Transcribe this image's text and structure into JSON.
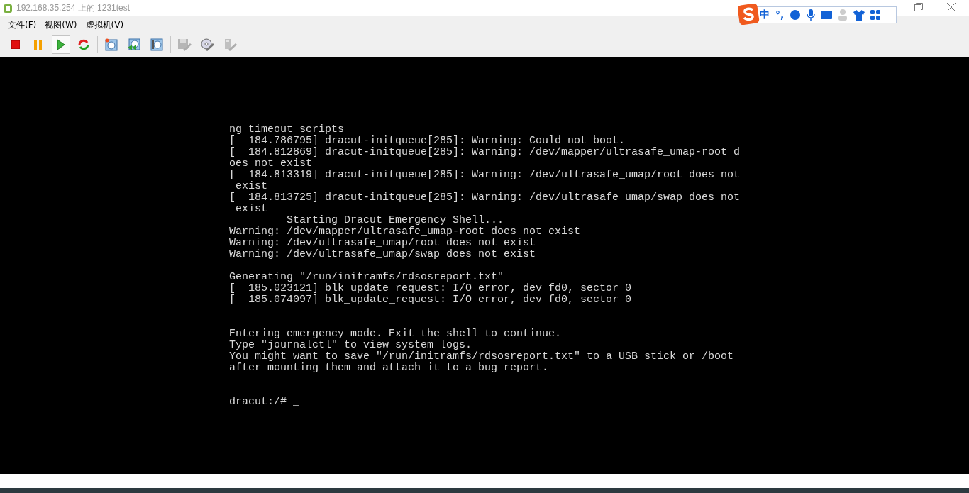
{
  "window": {
    "title": "192.168.35.254 上的 1231test"
  },
  "ime_bar": {
    "mode": "中",
    "punctuation": "°,"
  },
  "menu": [
    "文件(F)",
    "视图(W)",
    "虚拟机(V)"
  ],
  "toolbar": [
    {
      "kind": "stop",
      "selected": false,
      "disabled": false
    },
    {
      "kind": "pause",
      "selected": false,
      "disabled": false
    },
    {
      "kind": "play",
      "selected": true,
      "disabled": false
    },
    {
      "kind": "reset",
      "selected": false,
      "disabled": false
    },
    {
      "kind": "snapshot",
      "selected": false,
      "disabled": false
    },
    {
      "kind": "revert",
      "selected": false,
      "disabled": false
    },
    {
      "kind": "manage",
      "selected": false,
      "disabled": false
    },
    {
      "kind": "floppy",
      "selected": false,
      "disabled": true
    },
    {
      "kind": "cd",
      "selected": false,
      "disabled": false
    },
    {
      "kind": "usb",
      "selected": false,
      "disabled": true
    }
  ],
  "console": {
    "blocks": [
      {
        "kind": "first",
        "lines": [
          "ng timeout scripts",
          "[  184.786795] dracut-initqueue[285]: Warning: Could not boot.",
          "[  184.812869] dracut-initqueue[285]: Warning: /dev/mapper/ultrasafe_umap-root d",
          "oes not exist",
          "[  184.813319] dracut-initqueue[285]: Warning: /dev/ultrasafe_umap/root does not",
          " exist",
          "[  184.813725] dracut-initqueue[285]: Warning: /dev/ultrasafe_umap/swap does not",
          " exist",
          "         Starting Dracut Emergency Shell...",
          "Warning: /dev/mapper/ultrasafe_umap-root does not exist",
          "Warning: /dev/ultrasafe_umap/root does not exist",
          "Warning: /dev/ultrasafe_umap/swap does not exist"
        ]
      },
      {
        "kind": "spaced",
        "lines": [
          "Generating \"/run/initramfs/rdsosreport.txt\"",
          "[  185.023121] blk_update_request: I/O error, dev fd0, sector 0",
          "[  185.074097] blk_update_request: I/O error, dev fd0, sector 0"
        ]
      },
      {
        "kind": "wide",
        "lines": [
          "Entering emergency mode. Exit the shell to continue.",
          "Type \"journalctl\" to view system logs.",
          "You might want to save \"/run/initramfs/rdsosreport.txt\" to a USB stick or /boot",
          "after mounting them and attach it to a bug report."
        ]
      }
    ],
    "prompt": "dracut:/#",
    "cursor": "_"
  }
}
